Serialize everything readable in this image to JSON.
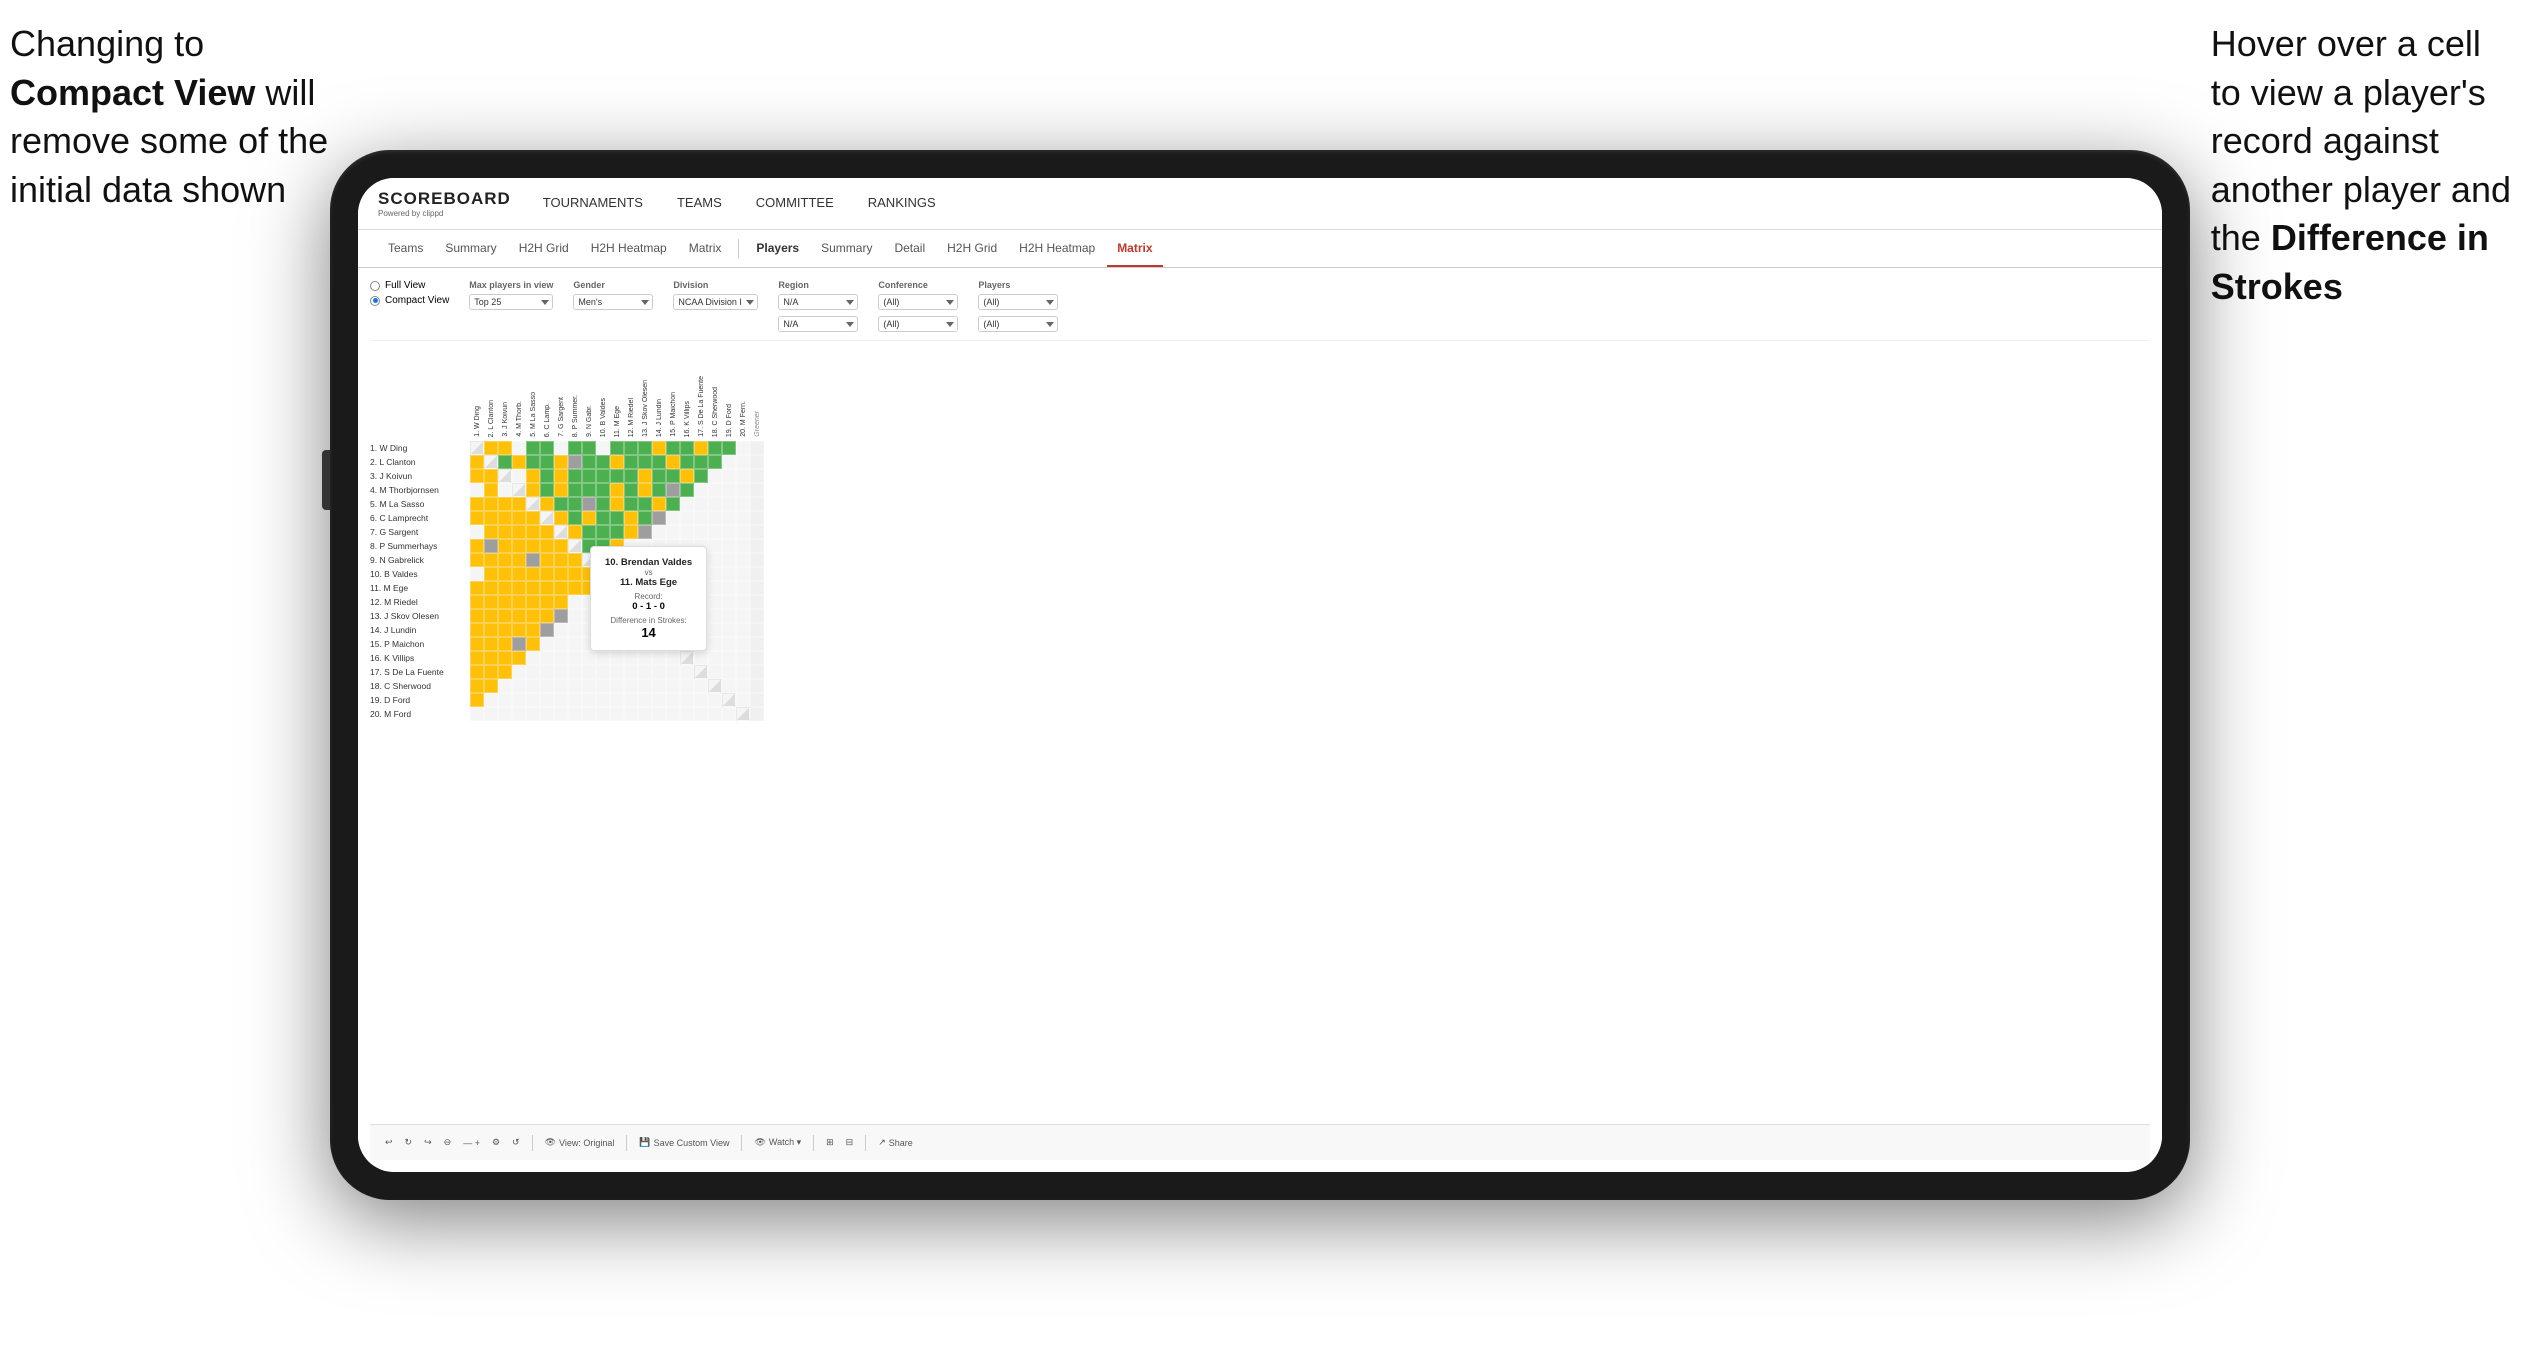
{
  "annotations": {
    "left": {
      "line1": "Changing to",
      "line2_bold": "Compact View",
      "line2_rest": " will",
      "line3": "remove some of the",
      "line4": "initial data shown"
    },
    "right": {
      "line1": "Hover over a cell",
      "line2": "to view a player's",
      "line3": "record against",
      "line4": "another player and",
      "line5_pre": "the ",
      "line5_bold": "Difference in",
      "line6": "Strokes"
    }
  },
  "brand": {
    "name": "SCOREBOARD",
    "sub": "Powered by clippd"
  },
  "nav": {
    "items": [
      "TOURNAMENTS",
      "TEAMS",
      "COMMITTEE",
      "RANKINGS"
    ]
  },
  "sub_nav": {
    "group1": [
      "Teams",
      "Summary",
      "H2H Grid",
      "H2H Heatmap",
      "Matrix"
    ],
    "group2_label": "Players",
    "group2_items": [
      "Summary",
      "Detail",
      "H2H Grid",
      "H2H Heatmap",
      "Matrix"
    ]
  },
  "filters": {
    "view_options": [
      "Full View",
      "Compact View"
    ],
    "max_players_label": "Max players in view",
    "max_players_value": "Top 25",
    "gender_label": "Gender",
    "gender_value": "Men's",
    "division_label": "Division",
    "division_value": "NCAA Division I",
    "region_label": "Region",
    "region_values": [
      "N/A",
      "N/A"
    ],
    "conference_label": "Conference",
    "conference_values": [
      "(All)",
      "(All)"
    ],
    "players_label": "Players",
    "players_values": [
      "(All)",
      "(All)"
    ]
  },
  "players": [
    "1. W Ding",
    "2. L Clanton",
    "3. J Koivun",
    "4. M Thorbjornsen",
    "5. M La Sasso",
    "6. C Lamprecht",
    "7. G Sargent",
    "8. P Summerhays",
    "9. N Gabrelick",
    "10. B Valdes",
    "11. M Ege",
    "12. M Riedel",
    "13. J Skov Olesen",
    "14. J Lundin",
    "15. P Maichon",
    "16. K Villips",
    "17. S De La Fuente",
    "18. C Sherwood",
    "19. D Ford",
    "20. M Ford"
  ],
  "col_headers": [
    "1. W Ding",
    "2. L Clanton",
    "3. J Koivun",
    "4. M Thorb.",
    "5. M La Sasso",
    "6. C Lamp.",
    "7. G Sargent",
    "8. P Summer.",
    "9. N Gabr.",
    "10. B Valdes",
    "11. M Ege",
    "12. M Riedel",
    "13. J Skov Olesen",
    "14. J Lundin",
    "15. P Maichon",
    "16. K Villips",
    "17. S De La Fuente",
    "18. C Sherwood",
    "19. D Ford",
    "20. M Fern.",
    "Greener"
  ],
  "tooltip": {
    "player1": "10. Brendan Valdes",
    "vs": "vs",
    "player2": "11. Mats Ege",
    "record_label": "Record:",
    "record": "0 - 1 - 0",
    "strokes_label": "Difference in Strokes:",
    "strokes": "14"
  },
  "toolbar": {
    "undo": "↩",
    "redo": "↪",
    "zoom_out": "⊖",
    "zoom_in": "⊕",
    "refresh": "↺",
    "view_original": "View: Original",
    "save_custom": "Save Custom View",
    "watch": "Watch ▾",
    "share": "Share",
    "settings": "⚙"
  }
}
